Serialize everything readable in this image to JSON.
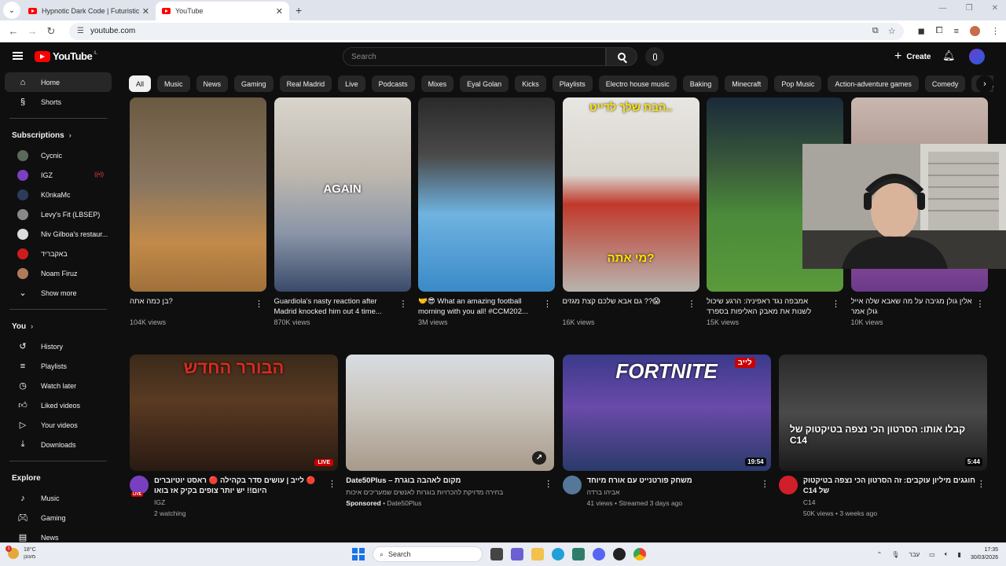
{
  "browser": {
    "tabs": [
      {
        "title": "Hypnotic Dark Code | Futuristic",
        "active": false
      },
      {
        "title": "YouTube",
        "active": true
      }
    ],
    "url": "youtube.com"
  },
  "header": {
    "logo_text": "YouTube",
    "region": "IL",
    "search_placeholder": "Search",
    "create_label": "Create"
  },
  "sidebar": {
    "main": [
      {
        "label": "Home",
        "icon": "home-icon",
        "active": true
      },
      {
        "label": "Shorts",
        "icon": "shorts-icon",
        "active": false
      }
    ],
    "subscriptions_title": "Subscriptions",
    "subscriptions": [
      {
        "label": "Cycnic",
        "color": "#5a6a5a"
      },
      {
        "label": "IGZ",
        "color": "#7a3fbf",
        "live": true
      },
      {
        "label": "K0nkaMc",
        "color": "#2e3a5a"
      },
      {
        "label": "Levy's Fit (LBSEP)",
        "color": "#888888"
      },
      {
        "label": "Niv Gilboa's restaur...",
        "color": "#dddddd"
      },
      {
        "label": "באקבריד",
        "color": "#cc1d1d"
      },
      {
        "label": "Noam Firuz",
        "color": "#b07a5a"
      }
    ],
    "show_more": "Show more",
    "you_title": "You",
    "you_items": [
      {
        "label": "History",
        "icon": "history-icon"
      },
      {
        "label": "Playlists",
        "icon": "playlists-icon"
      },
      {
        "label": "Watch later",
        "icon": "watch-later-icon"
      },
      {
        "label": "Liked videos",
        "icon": "like-icon"
      },
      {
        "label": "Your videos",
        "icon": "your-videos-icon"
      },
      {
        "label": "Downloads",
        "icon": "download-icon"
      }
    ],
    "explore_title": "Explore",
    "explore_items": [
      {
        "label": "Music",
        "icon": "music-icon"
      },
      {
        "label": "Gaming",
        "icon": "gaming-icon"
      },
      {
        "label": "News",
        "icon": "news-icon"
      }
    ]
  },
  "chips": [
    "All",
    "Music",
    "News",
    "Gaming",
    "Real Madrid",
    "Live",
    "Podcasts",
    "Mixes",
    "Eyal Golan",
    "Kicks",
    "Playlists",
    "Electro house music",
    "Baking",
    "Minecraft",
    "Pop Music",
    "Action-adventure games",
    "Comedy",
    "Bodybuilding"
  ],
  "shorts": [
    {
      "title": "?בן כמה אתה",
      "views": "104K views",
      "overlay": "",
      "bg": "linear-gradient(180deg,#6b5a42 0%,#8a7660 45%,#c28a4a 75%,#a0703a 100%)"
    },
    {
      "title": "Guardiola's nasty reaction after Madrid knocked him out 4 time...",
      "views": "870K views",
      "overlay": "AGAIN",
      "bg": "linear-gradient(180deg,#d9d4cc 0%,#bdb7ae 40%,#8a95a8 70%,#3a4a6a 100%)"
    },
    {
      "title": "🤝😎 What an amazing football morning with you all! #CCM202...",
      "views": "3M views",
      "overlay": "",
      "bg": "linear-gradient(180deg,#2a2a2a 0%,#4a4a4a 30%,#6fb3e0 60%,#3a8ac8 100%)"
    },
    {
      "title": "😱?? גם אבא שלכם קצת מגזים",
      "views": "16K views",
      "overlay": "מי אתה?",
      "overlay_top": "הבת שלך לדייט..",
      "bg": "linear-gradient(180deg,#e8e6e2 0%,#d8d4ce 40%,#c0392b 55%,#b8b4ae 100%)"
    },
    {
      "title": "אמבפה נגד ראפיניה: הרגע שיכול לשנות את מאבק האליפות בספרד",
      "views": "15K views",
      "overlay": "",
      "bg": "linear-gradient(180deg,#1a2a3a 0%,#3a5a3a 35%,#4a8a3a 60%,#5a9a3a 100%)"
    },
    {
      "title": "אלין גולן מגיבה על מה שאבא שלה אייל גולן אמר",
      "views": "10K views",
      "overlay": "",
      "bg": "linear-gradient(180deg,#c9b8b0 0%,#a89088 40%,#8a4a9a 80%,#6a3a8a 100%)"
    }
  ],
  "videos": [
    {
      "title": "🔴 לייב | עושים סדר בקהילה 🔴 ראסט יוטיוברים היום!! יש יותר צופים בקיק אז בואו",
      "channel": "IGZ",
      "stats": "2 watching",
      "badge": "LIVE",
      "avatar": "#7a3fbf",
      "bg": "linear-gradient(180deg,#3a2a1a 0%,#5a3a22 40%,#2a1a12 100%)",
      "overlay": "הבורר החדש"
    },
    {
      "title": "מקום לאהבה בוגרת – Date50Plus",
      "desc": "בחירה מדויקת להכרויות בוגרות לאנשים שמעריכים איכות",
      "sponsored": "Sponsored",
      "advertiser": "Date50Plus",
      "bg": "linear-gradient(180deg,#d8dde2 0%,#c9c4bc 45%,#a89a8a 100%)"
    },
    {
      "title": "משחק פורטנייט עם אורח מיוחד",
      "channel": "אביהו ברדה",
      "stats": "41 views • Streamed 3 days ago",
      "duration": "19:54",
      "avatar": "#557799",
      "bg": "linear-gradient(180deg,#3a3a8a 0%,#6a4aaa 45%,#2a3a6a 100%)",
      "overlay": "FORTNITE",
      "corner": "לייב"
    },
    {
      "title": "חוגגים מיליון עוקבים: זה הסרטון הכי נצפה בטיקטוק של C14",
      "channel": "C14",
      "stats": "50K views • 3 weeks ago",
      "duration": "5:44",
      "avatar": "#d01f2a",
      "bg": "linear-gradient(180deg,#2a2a2a 0%,#4a4a4a 50%,#1a1a1a 100%)",
      "overlay": "קבלו אותו: הסרטון הכי נצפה בטיקטוק של C14"
    }
  ],
  "taskbar": {
    "weather_temp": "18°C",
    "weather_desc": "מעונן",
    "weather_badge": "1",
    "search": "Search",
    "lang": "עבר",
    "time": "17:35",
    "date": "30/03/2026"
  }
}
